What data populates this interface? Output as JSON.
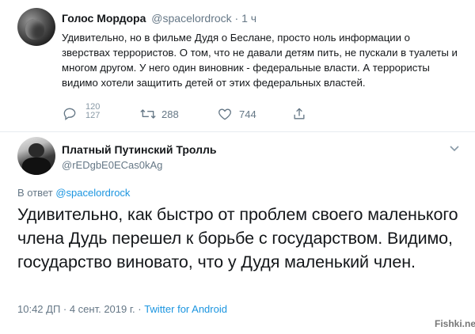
{
  "tweet": {
    "author_name": "Голос Мордора",
    "author_handle": "@spacelordrock",
    "time_sep": " · ",
    "time": "1 ч",
    "text": "Удивительно, но в фильме Дудя о Беслане, просто ноль информации о зверствах террористов. О том, что не давали детям пить, не пускали в туалеты и многом другом. У него один виновник - федеральные власти. А террористы видимо хотели защитить детей от этих федеральных властей.",
    "reply_count_top": "120",
    "reply_count_bottom": "127",
    "retweet_count": "288",
    "like_count": "744"
  },
  "reply": {
    "author_name": "Платный Путинский Тролль",
    "author_handle": "@rEDgbE0ECas0kAg",
    "reply_prefix": "В ответ ",
    "reply_to": "@spacelordrock",
    "text": "Удивительно, как быстро от проблем своего маленького члена Дудь перешел к борьбе с государством. Видимо, государство виновато, что у Дудя маленький член.",
    "timestamp": "10:42 ДП · 4 сент. 2019 г. · ",
    "client": "Twitter for Android"
  },
  "watermark": "Fishki.net",
  "colors": {
    "text": "#14171a",
    "secondary": "#657786",
    "link": "#1b95e0",
    "divider": "#e6ecf0"
  }
}
